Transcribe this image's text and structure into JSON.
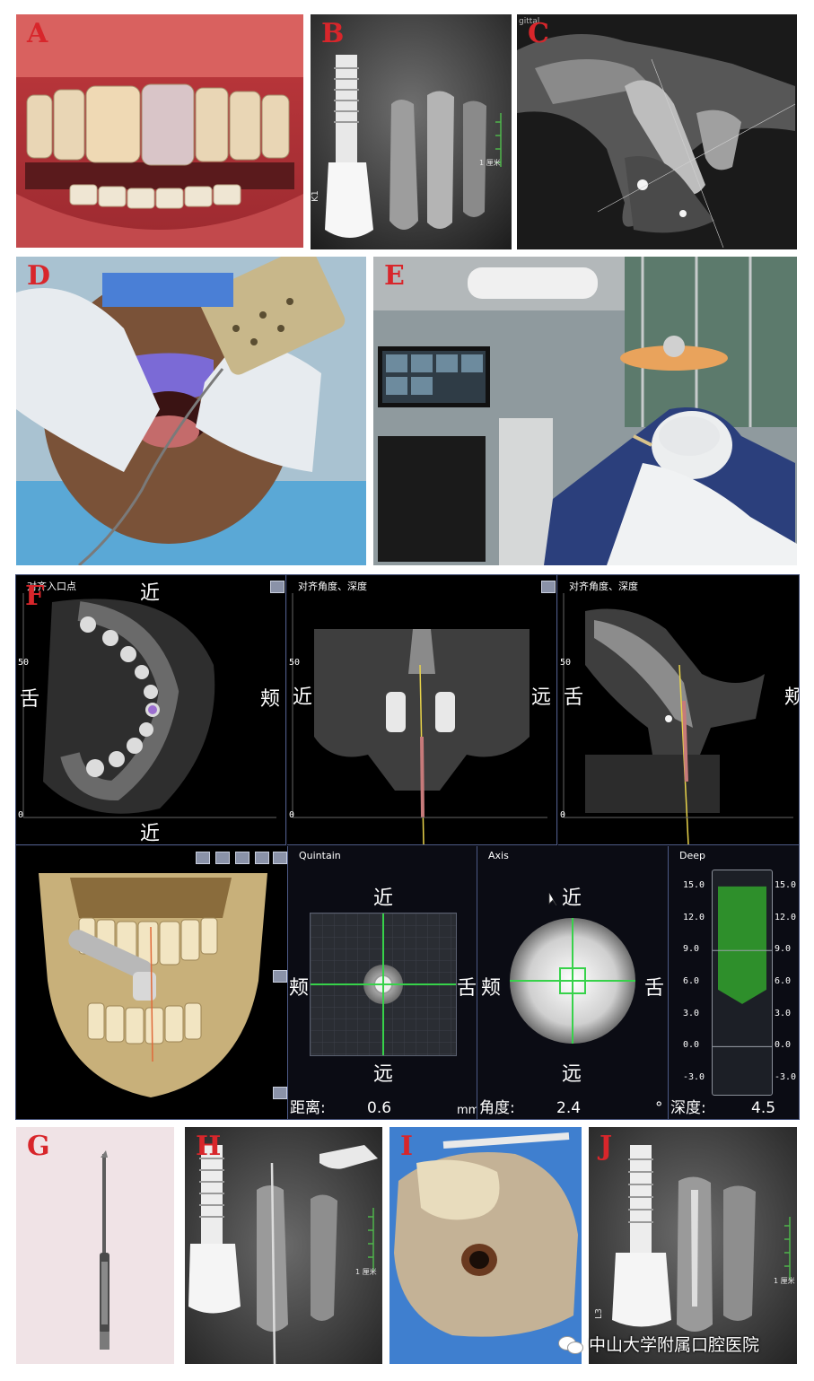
{
  "panels": {
    "a": {
      "letter": "A"
    },
    "b": {
      "letter": "B",
      "marker": "K1",
      "scale": "1 厘米"
    },
    "c": {
      "letter": "C",
      "corner_text": "gittal"
    },
    "d": {
      "letter": "D"
    },
    "e": {
      "letter": "E"
    },
    "f": {
      "letter": "F",
      "view1": {
        "header": "对齐入口点",
        "top": "近",
        "bottom": "近",
        "left": "舌",
        "right": "颊",
        "axis_50": "50",
        "axis_0": "0"
      },
      "view2": {
        "header": "对齐角度、深度",
        "left": "近",
        "right": "远",
        "axis_50": "50",
        "axis_0": "0"
      },
      "view3": {
        "header": "对齐角度、深度",
        "left": "舌",
        "right": "颊",
        "axis_50": "50",
        "axis_0": "0"
      },
      "quintain": {
        "title": "Quintain",
        "top": "近",
        "bottom": "远",
        "left": "颊",
        "right": "舌",
        "readout_label": "距离:",
        "readout_value": "0.6",
        "readout_unit": "mm"
      },
      "axis": {
        "title": "Axis",
        "top": "近",
        "bottom": "远",
        "left": "颊",
        "right": "舌",
        "readout_label": "角度:",
        "readout_value": "2.4",
        "readout_unit": "°"
      },
      "deep": {
        "title": "Deep",
        "readout_label": "深度:",
        "readout_value": "4.5",
        "ticks": [
          "15.0",
          "12.0",
          "9.0",
          "6.0",
          "3.0",
          "0.0",
          "-3.0"
        ],
        "fill_top_mm": 15.0,
        "fill_bottom_mm": 4.5
      }
    },
    "g": {
      "letter": "G"
    },
    "h": {
      "letter": "H",
      "scale": "1 厘米"
    },
    "i": {
      "letter": "I"
    },
    "j": {
      "letter": "J",
      "marker": "L3",
      "scale": "1 厘米"
    }
  },
  "watermark": {
    "text": "中山大学附属口腔医院",
    "icon": "wechat-icon"
  },
  "colors": {
    "letter": "#d8262b",
    "nav_panel_bg": "#0b0c14",
    "nav_border": "#3e4a73",
    "deep_fill": "#2e8f2b",
    "guide_green": "#37d24a"
  }
}
